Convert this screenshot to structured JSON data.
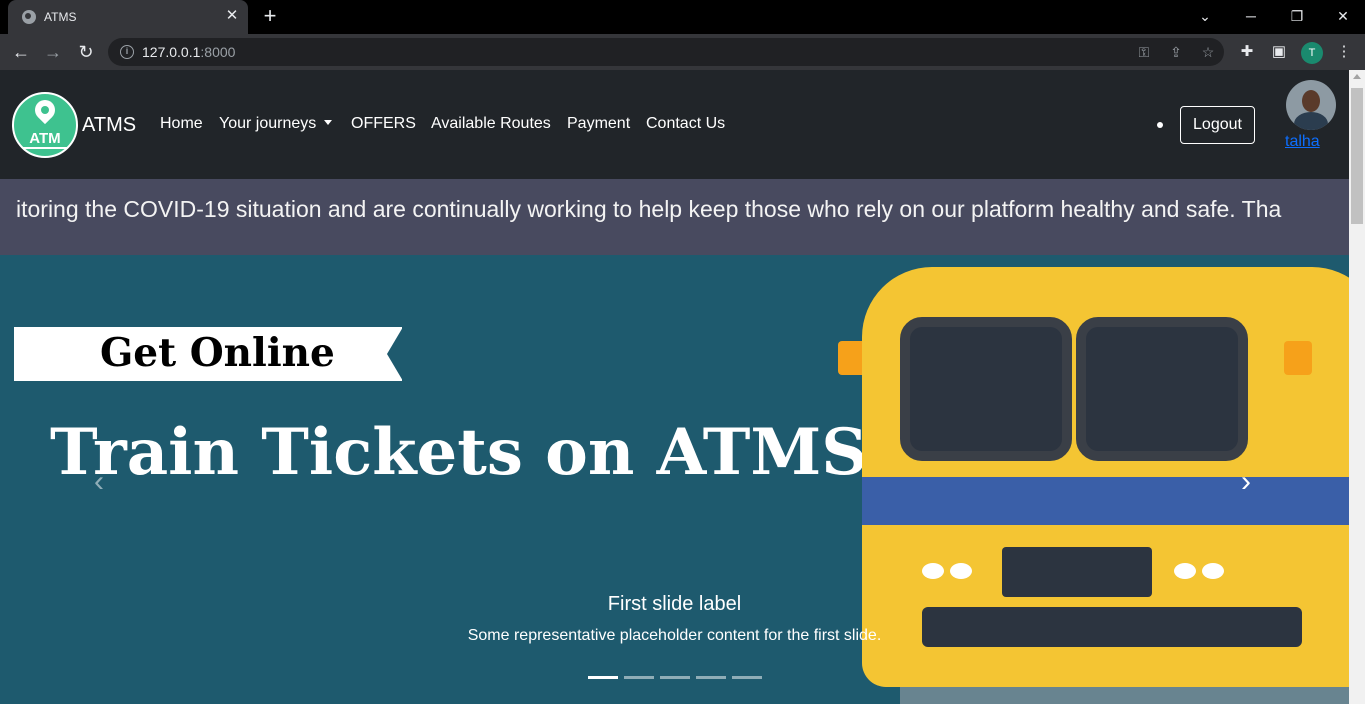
{
  "browser": {
    "tab_title": "ATMS",
    "url_host": "127.0.0.1",
    "url_port": ":8000",
    "profile_initial": "T"
  },
  "navbar": {
    "brand_logo_text": "ATM",
    "brand_name": "ATMS",
    "links": [
      "Home",
      "Your journeys",
      "OFFERS",
      "Available Routes",
      "Payment",
      "Contact Us"
    ],
    "logout_label": "Logout",
    "username": "talha"
  },
  "marquee": {
    "text": "itoring the COVID-19 situation and are continually working to help keep those who rely on our platform healthy and safe. Tha"
  },
  "carousel": {
    "banner_top": "Get Online",
    "banner_main": "Train Tickets on ATMS",
    "caption_title": "First slide label",
    "caption_text": "Some representative placeholder content for the first slide.",
    "slide_count": 5,
    "active_slide": 1
  },
  "colors": {
    "navbar_bg": "#212529",
    "marquee_bg": "#484a5f",
    "carousel_bg": "#1e5a6e",
    "brand_logo_bg": "#3ec28f",
    "train_yellow": "#f4c533",
    "link_blue": "#0d6efd"
  }
}
